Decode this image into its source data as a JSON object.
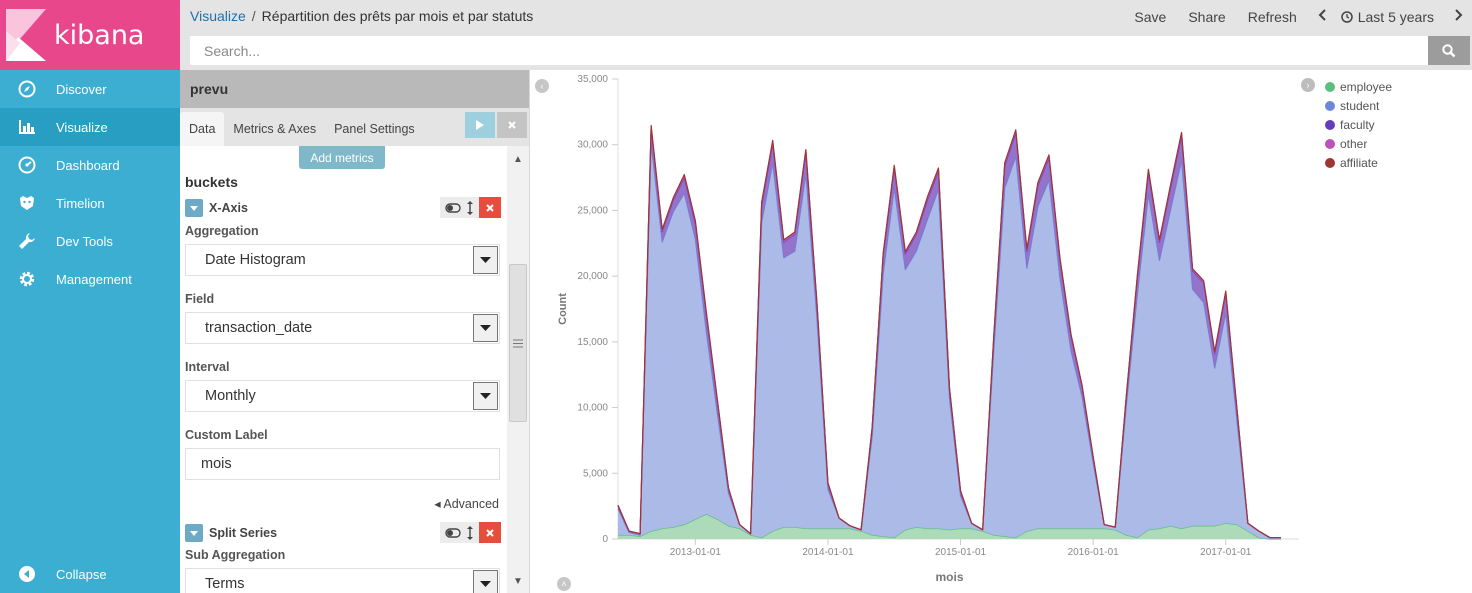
{
  "app": {
    "name": "kibana"
  },
  "nav": {
    "items": [
      {
        "label": "Discover",
        "icon": "compass-icon"
      },
      {
        "label": "Visualize",
        "icon": "bar-chart-icon"
      },
      {
        "label": "Dashboard",
        "icon": "dashboard-icon"
      },
      {
        "label": "Timelion",
        "icon": "timelion-icon"
      },
      {
        "label": "Dev Tools",
        "icon": "wrench-icon"
      },
      {
        "label": "Management",
        "icon": "gear-icon"
      }
    ],
    "active": "Visualize",
    "collapse_label": "Collapse"
  },
  "topbar": {
    "breadcrumb_root": "Visualize",
    "breadcrumb_sep": "/",
    "title": "Répartition des prêts par mois et par statuts",
    "save": "Save",
    "share": "Share",
    "refresh": "Refresh",
    "time": "Last 5 years",
    "search_placeholder": "Search..."
  },
  "editor": {
    "index": "prevu",
    "tabs": [
      "Data",
      "Metrics & Axes",
      "Panel Settings"
    ],
    "active_tab": "Data",
    "add_metrics": "Add metrics",
    "buckets_heading": "buckets",
    "xaxis": {
      "title": "X-Axis",
      "aggregation_label": "Aggregation",
      "aggregation": "Date Histogram",
      "field_label": "Field",
      "field": "transaction_date",
      "interval_label": "Interval",
      "interval": "Monthly",
      "custom_label_label": "Custom Label",
      "custom_label": "mois",
      "advanced": "Advanced"
    },
    "split": {
      "title": "Split Series",
      "sub_aggregation_label": "Sub Aggregation",
      "sub_aggregation": "Terms"
    }
  },
  "colors": {
    "brand_pink": "#e8488b",
    "nav_blue": "#3caed2",
    "employee": "#57c17b",
    "student": "#6f87d8",
    "faculty": "#663db8",
    "other": "#bc52bc",
    "affiliate": "#9e3533"
  },
  "chart_data": {
    "type": "area",
    "stacked": true,
    "xlabel": "mois",
    "ylabel": "Count",
    "ylim": [
      0,
      35000
    ],
    "yticks": [
      0,
      5000,
      10000,
      15000,
      20000,
      25000,
      30000,
      35000
    ],
    "ytick_labels": [
      "0",
      "5,000",
      "10,000",
      "15,000",
      "20,000",
      "25,000",
      "30,000",
      "35,000"
    ],
    "x_start": "2012-06",
    "x_end": "2017-06",
    "xticks": [
      "2013-01-01",
      "2014-01-01",
      "2015-01-01",
      "2016-01-01",
      "2017-01-01"
    ],
    "x": [
      "2012-06",
      "2012-07",
      "2012-08",
      "2012-09",
      "2012-10",
      "2012-11",
      "2012-12",
      "2013-01",
      "2013-02",
      "2013-03",
      "2013-04",
      "2013-05",
      "2013-06",
      "2013-07",
      "2013-08",
      "2013-09",
      "2013-10",
      "2013-11",
      "2013-12",
      "2014-01",
      "2014-02",
      "2014-03",
      "2014-04",
      "2014-05",
      "2014-06",
      "2014-07",
      "2014-08",
      "2014-09",
      "2014-10",
      "2014-11",
      "2014-12",
      "2015-01",
      "2015-02",
      "2015-03",
      "2015-04",
      "2015-05",
      "2015-06",
      "2015-07",
      "2015-08",
      "2015-09",
      "2015-10",
      "2015-11",
      "2015-12",
      "2016-01",
      "2016-02",
      "2016-03",
      "2016-04",
      "2016-05",
      "2016-06",
      "2016-07",
      "2016-08",
      "2016-09",
      "2016-10",
      "2016-11",
      "2016-12",
      "2017-01",
      "2017-02",
      "2017-03",
      "2017-04",
      "2017-05",
      "2017-06"
    ],
    "legend_position": "top-right",
    "series": [
      {
        "name": "employee",
        "values": [
          300,
          300,
          200,
          600,
          800,
          900,
          1100,
          1500,
          1900,
          1500,
          1000,
          800,
          300,
          100,
          600,
          900,
          900,
          800,
          800,
          800,
          800,
          800,
          600,
          300,
          200,
          100,
          700,
          900,
          800,
          800,
          700,
          800,
          800,
          600,
          300,
          200,
          100,
          600,
          800,
          800,
          800,
          800,
          800,
          800,
          800,
          700,
          300,
          100,
          700,
          800,
          1000,
          800,
          1000,
          1000,
          1000,
          1200,
          1100,
          600,
          100,
          0,
          0
        ]
      },
      {
        "name": "student",
        "values": [
          2000,
          200,
          100,
          29500,
          21800,
          24000,
          25200,
          21300,
          13800,
          8000,
          2500,
          300,
          100,
          24000,
          28000,
          20500,
          21000,
          27000,
          16000,
          3000,
          800,
          200,
          100,
          7500,
          20000,
          26600,
          19800,
          21000,
          23500,
          25800,
          10000,
          2500,
          400,
          100,
          14000,
          26500,
          29000,
          20000,
          24500,
          26500,
          19000,
          13500,
          10000,
          5000,
          300,
          200,
          9800,
          18500,
          25500,
          20400,
          24000,
          28000,
          18000,
          17000,
          12000,
          16000,
          8000,
          600,
          500,
          100,
          100
        ]
      },
      {
        "name": "faculty",
        "values": [
          200,
          100,
          100,
          1200,
          800,
          900,
          1200,
          1200,
          1300,
          900,
          300,
          0,
          0,
          1300,
          1500,
          1200,
          1300,
          1600,
          1100,
          400,
          0,
          0,
          0,
          600,
          1400,
          1500,
          1200,
          1300,
          1500,
          1400,
          700,
          300,
          0,
          0,
          900,
          1700,
          1800,
          1300,
          1600,
          1700,
          1400,
          1100,
          800,
          400,
          0,
          0,
          700,
          1300,
          1700,
          1400,
          1700,
          1900,
          1400,
          1500,
          1100,
          1500,
          800,
          0,
          0,
          0,
          0
        ]
      },
      {
        "name": "other",
        "values": [
          50,
          0,
          0,
          100,
          100,
          100,
          150,
          150,
          150,
          100,
          50,
          0,
          0,
          150,
          150,
          100,
          100,
          150,
          100,
          50,
          0,
          0,
          0,
          50,
          100,
          150,
          100,
          100,
          150,
          150,
          50,
          50,
          0,
          0,
          100,
          150,
          150,
          100,
          150,
          150,
          100,
          100,
          50,
          50,
          0,
          0,
          50,
          100,
          150,
          100,
          150,
          150,
          100,
          100,
          100,
          100,
          100,
          0,
          0,
          0,
          0
        ]
      },
      {
        "name": "affiliate",
        "values": [
          30,
          0,
          0,
          60,
          60,
          60,
          80,
          80,
          80,
          60,
          30,
          0,
          0,
          80,
          80,
          60,
          60,
          80,
          60,
          30,
          0,
          0,
          0,
          30,
          60,
          80,
          60,
          60,
          80,
          80,
          30,
          30,
          0,
          0,
          60,
          80,
          80,
          60,
          80,
          80,
          60,
          60,
          30,
          30,
          0,
          0,
          30,
          60,
          80,
          60,
          80,
          80,
          60,
          60,
          60,
          60,
          60,
          0,
          0,
          0,
          0
        ]
      }
    ]
  }
}
